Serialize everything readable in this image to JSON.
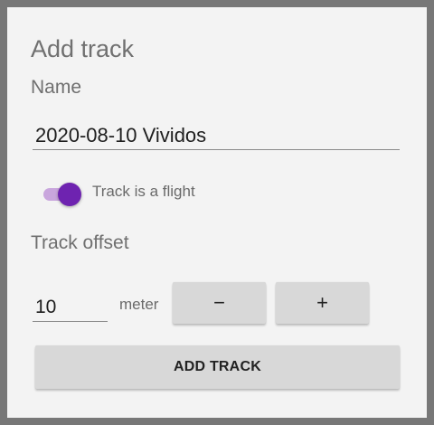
{
  "dialog": {
    "title": "Add track",
    "name_label": "Name",
    "name_value": "2020-08-10 Vividos",
    "flight_switch": {
      "label": "Track is a flight",
      "checked": true,
      "accent_color": "#6e23b0",
      "track_color": "#c9a6dd"
    },
    "offset_label": "Track offset",
    "offset_value": "10",
    "offset_unit": "meter",
    "minus_label": "−",
    "plus_label": "+",
    "add_button_label": "ADD TRACK"
  }
}
